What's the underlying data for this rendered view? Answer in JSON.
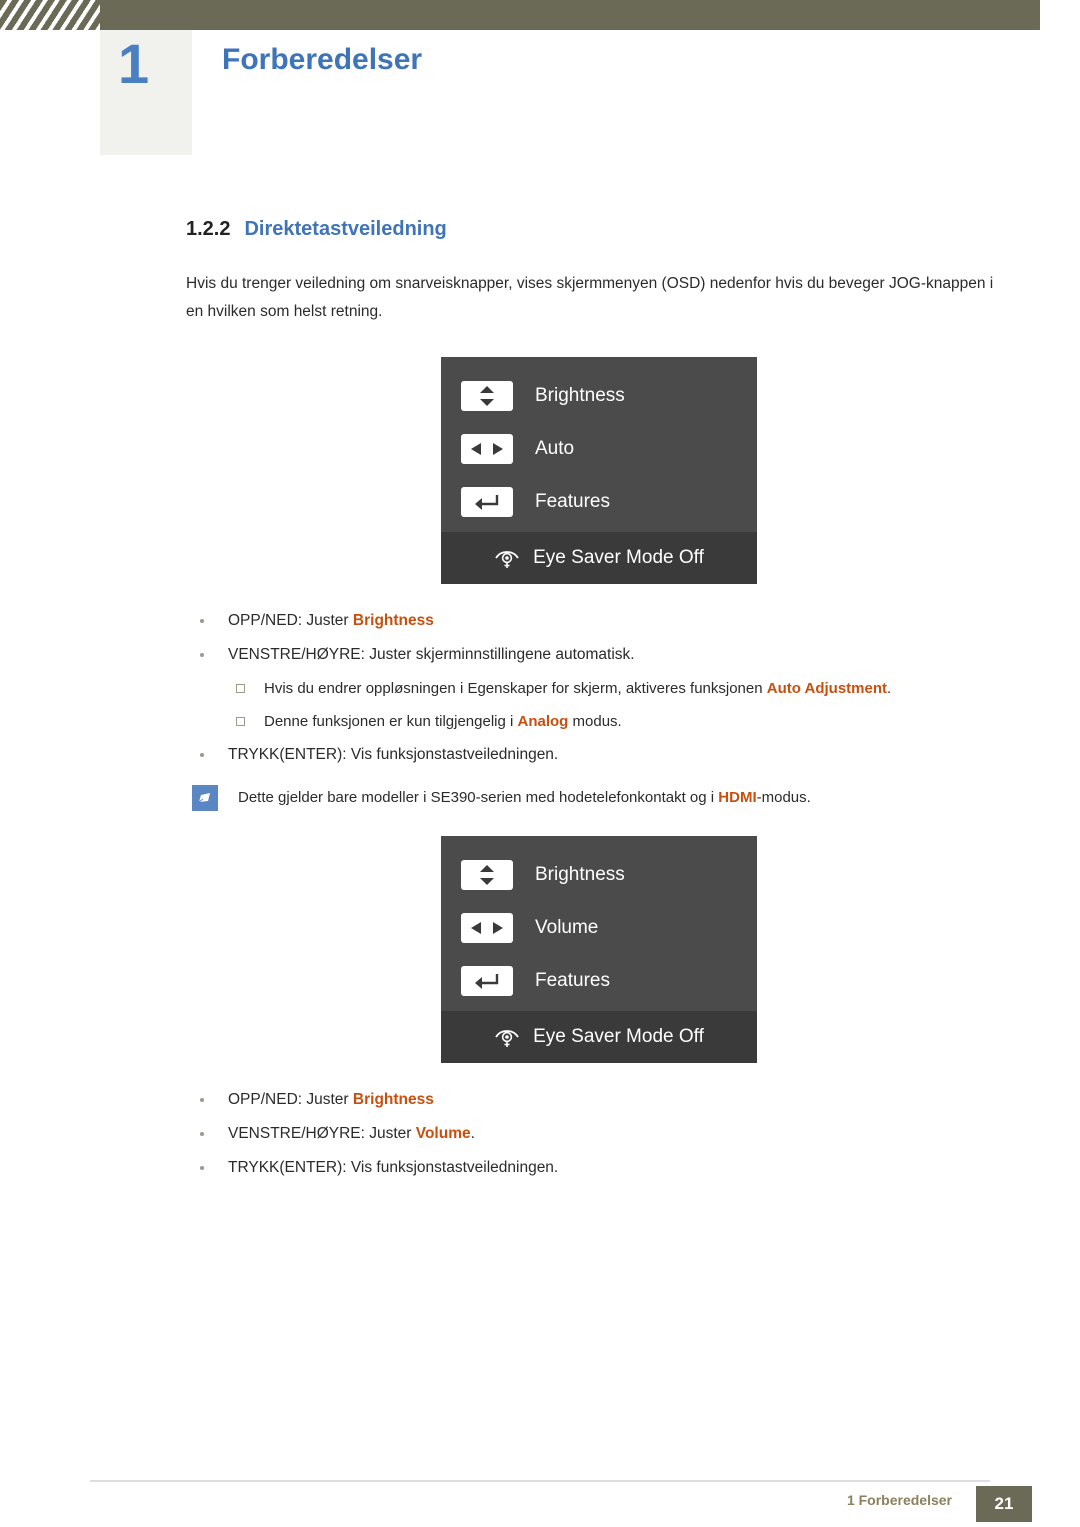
{
  "header": {
    "chapter_number": "1",
    "chapter_title": "Forberedelser"
  },
  "section": {
    "number": "1.2.2",
    "title": "Direktetastveiledning"
  },
  "intro": "Hvis du trenger veiledning om snarveisknapper, vises skjermmenyen (OSD) nedenfor hvis du beveger JOG-knappen i en hvilken som helst retning.",
  "osd_panels": [
    {
      "rows": [
        {
          "icon": "up-down-arrow-icon",
          "label": "Brightness"
        },
        {
          "icon": "left-right-arrow-icon",
          "label": "Auto"
        },
        {
          "icon": "enter-arrow-icon",
          "label": "Features"
        }
      ],
      "footer": {
        "icon": "eye-saver-icon",
        "label": "Eye Saver Mode Off"
      }
    },
    {
      "rows": [
        {
          "icon": "up-down-arrow-icon",
          "label": "Brightness"
        },
        {
          "icon": "left-right-arrow-icon",
          "label": "Volume"
        },
        {
          "icon": "enter-arrow-icon",
          "label": "Features"
        }
      ],
      "footer": {
        "icon": "eye-saver-icon",
        "label": "Eye Saver Mode Off"
      }
    }
  ],
  "bullets_1": {
    "item1_pre": "OPP/NED: Juster ",
    "item1_hl": "Brightness",
    "item2": "VENSTRE/HØYRE: Juster skjerminnstillingene automatisk.",
    "sub1_pre": "Hvis du endrer oppløsningen i Egenskaper for skjerm, aktiveres funksjonen ",
    "sub1_hl": "Auto Adjustment",
    "sub1_post": ".",
    "sub2_pre": "Denne funksjonen er kun tilgjengelig i ",
    "sub2_hl": "Analog",
    "sub2_post": " modus.",
    "item3": "TRYKK(ENTER): Vis funksjonstastveiledningen."
  },
  "note": {
    "icon": "note-icon",
    "text_pre": "Dette gjelder bare modeller i SE390-serien med hodetelefonkontakt og i ",
    "text_hl": "HDMI",
    "text_post": "-modus."
  },
  "bullets_2": {
    "item1_pre": "OPP/NED: Juster ",
    "item1_hl": "Brightness",
    "item2_pre": "VENSTRE/HØYRE: Juster ",
    "item2_hl": "Volume",
    "item2_post": ".",
    "item3": "TRYKK(ENTER): Vis funksjonstastveiledningen."
  },
  "footer": {
    "text": "1 Forberedelser",
    "page": "21"
  },
  "colors": {
    "accent_blue": "#3f74b8",
    "highlight_orange": "#c8500f",
    "header_olive": "#6b6a57",
    "osd_bg": "#4b4b4b",
    "osd_foot_bg": "#3a3a3a"
  }
}
